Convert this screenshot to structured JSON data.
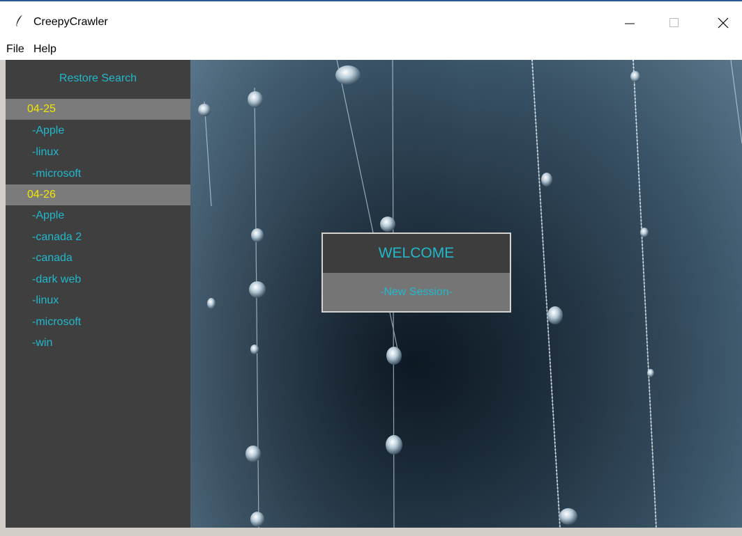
{
  "window": {
    "title": "CreepyCrawler",
    "icon": "feather-icon"
  },
  "menu": {
    "file": "File",
    "help": "Help"
  },
  "sidebar": {
    "restore_label": "Restore Search",
    "groups": [
      {
        "date": "04-25",
        "items": [
          "-Apple",
          "-linux",
          "-microsoft"
        ]
      },
      {
        "date": "04-26",
        "items": [
          "-Apple",
          "-canada 2",
          "-canada",
          "-dark web",
          "-linux",
          "-microsoft",
          "-win"
        ]
      }
    ]
  },
  "dialog": {
    "title": "WELCOME",
    "button": "-New Session-"
  },
  "colors": {
    "accent_text": "#22b8cc",
    "date_text": "#f2e600",
    "sidebar_bg": "#3f3f3f",
    "header_bg": "#7b7b7b"
  }
}
